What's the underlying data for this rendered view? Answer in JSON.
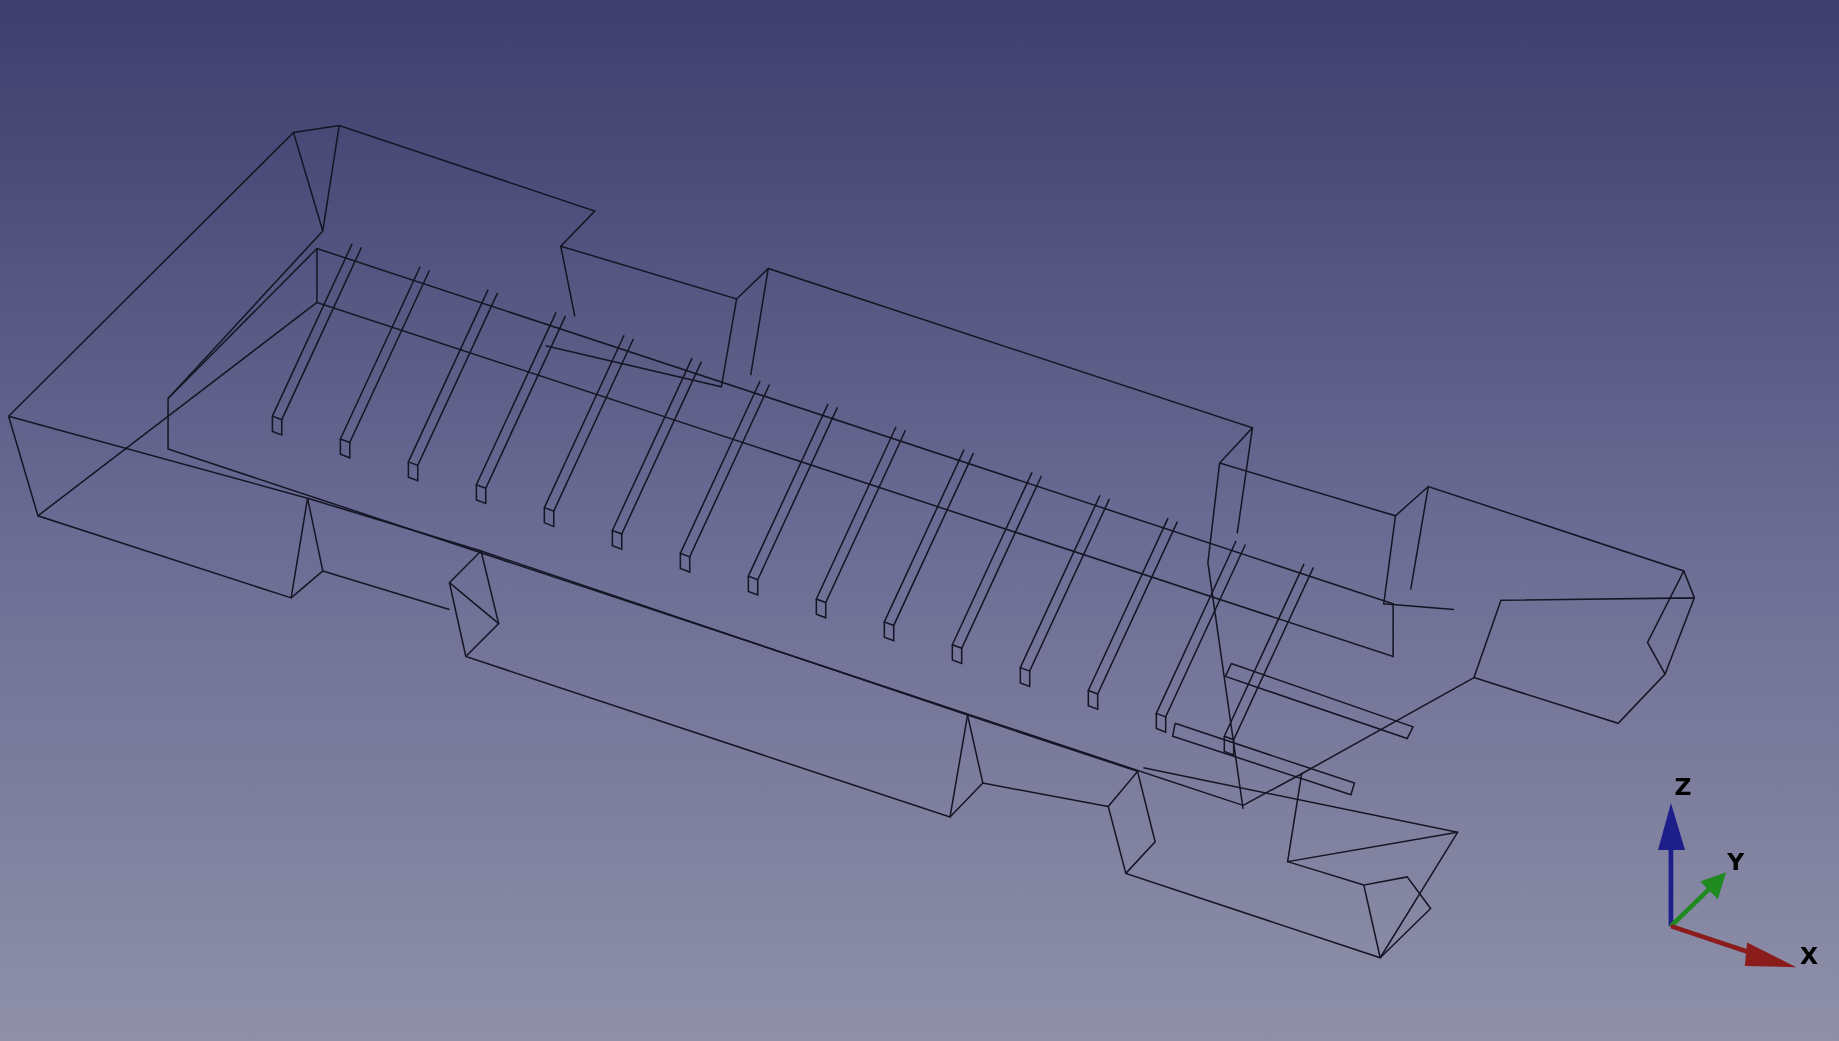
{
  "viewport": {
    "axes": [
      {
        "label": "Z",
        "color": "#1c1f8a",
        "kind": "up"
      },
      {
        "label": "Y",
        "color": "#1f8a1f",
        "kind": "depth"
      },
      {
        "label": "X",
        "color": "#8a1c1c",
        "kind": "right"
      }
    ]
  }
}
